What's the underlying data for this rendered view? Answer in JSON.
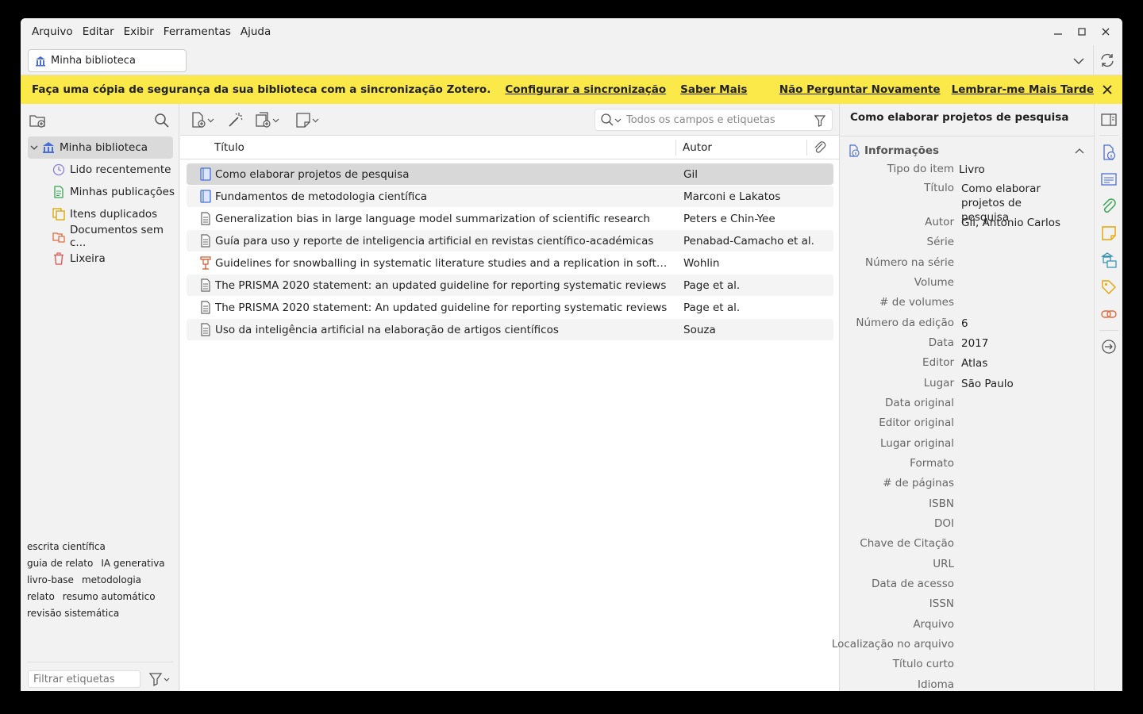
{
  "menu": [
    "Arquivo",
    "Editar",
    "Exibir",
    "Ferramentas",
    "Ajuda"
  ],
  "tab": {
    "label": "Minha biblioteca"
  },
  "banner": {
    "message": "Faça uma cópia de segurança da sua biblioteca com a sincronização Zotero.",
    "configure": "Configurar a sincronização",
    "learn_more": "Saber Mais",
    "dont_ask": "Não Perguntar Novamente",
    "remind_later": "Lembrar-me Mais Tarde",
    "color": "#fbe94a"
  },
  "collections": [
    {
      "label": "Minha biblioteca",
      "icon": "library-icon",
      "selected": true
    },
    {
      "label": "Lido recentemente",
      "icon": "clock-icon"
    },
    {
      "label": "Minhas publicações",
      "icon": "publications-icon"
    },
    {
      "label": "Itens duplicados",
      "icon": "duplicates-icon"
    },
    {
      "label": "Documentos sem c...",
      "icon": "unfiled-icon"
    },
    {
      "label": "Lixeira",
      "icon": "trash-icon"
    }
  ],
  "tags": [
    "escrita científica",
    "guia de relato",
    "IA generativa",
    "livro-base",
    "metodologia",
    "relato",
    "resumo automático",
    "revisão sistemática"
  ],
  "tag_filter_placeholder": "Filtrar etiquetas",
  "search": {
    "placeholder": "Todos os campos e etiquetas"
  },
  "columns": {
    "title": "Título",
    "author": "Autor"
  },
  "items": [
    {
      "title": "Como elaborar projetos de pesquisa",
      "author": "Gil",
      "type": "book"
    },
    {
      "title": "Fundamentos de metodologia científica",
      "author": "Marconi e Lakatos",
      "type": "book"
    },
    {
      "title": "Generalization bias in large language model summarization of scientific research",
      "author": "Peters e Chin-Yee",
      "type": "article"
    },
    {
      "title": "Guía para uso y reporte de inteligencia artificial en revistas científico-académicas",
      "author": "Penabad-Camacho et al.",
      "type": "article"
    },
    {
      "title": "Guidelines for snowballing in systematic literature studies and a replication in software engine...",
      "author": "Wohlin",
      "type": "conference"
    },
    {
      "title": "The PRISMA 2020 statement: an updated guideline for reporting systematic reviews",
      "author": "Page et al.",
      "type": "article"
    },
    {
      "title": "The PRISMA 2020 statement: An updated guideline for reporting systematic reviews",
      "author": "Page et al.",
      "type": "article"
    },
    {
      "title": "Uso da inteligência artificial na elaboração de artigos científicos",
      "author": "Souza",
      "type": "article"
    }
  ],
  "detail": {
    "title": "Como elaborar projetos de pesquisa",
    "section": "Informações",
    "fields": [
      {
        "label": "Tipo do item",
        "value": "Livro"
      },
      {
        "label": "Título",
        "value": "Como elaborar projetos de pesquisa"
      },
      {
        "label": "Autor",
        "value": "Gil, Antonio Carlos"
      },
      {
        "label": "Série",
        "value": ""
      },
      {
        "label": "Número na série",
        "value": ""
      },
      {
        "label": "Volume",
        "value": ""
      },
      {
        "label": "# de volumes",
        "value": ""
      },
      {
        "label": "Número da edição",
        "value": "6"
      },
      {
        "label": "Data",
        "value": "2017"
      },
      {
        "label": "Editor",
        "value": "Atlas"
      },
      {
        "label": "Lugar",
        "value": "São Paulo"
      },
      {
        "label": "Data original",
        "value": ""
      },
      {
        "label": "Editor original",
        "value": ""
      },
      {
        "label": "Lugar original",
        "value": ""
      },
      {
        "label": "Formato",
        "value": ""
      },
      {
        "label": "# de páginas",
        "value": ""
      },
      {
        "label": "ISBN",
        "value": ""
      },
      {
        "label": "DOI",
        "value": ""
      },
      {
        "label": "Chave de Citação",
        "value": ""
      },
      {
        "label": "URL",
        "value": ""
      },
      {
        "label": "Data de acesso",
        "value": ""
      },
      {
        "label": "ISSN",
        "value": ""
      },
      {
        "label": "Arquivo",
        "value": ""
      },
      {
        "label": "Localização no arquivo",
        "value": ""
      },
      {
        "label": "Título curto",
        "value": ""
      },
      {
        "label": "Idioma",
        "value": ""
      }
    ]
  },
  "sidenav": [
    "toggle-pane-icon",
    "info-icon",
    "abstract-icon",
    "attachments-icon",
    "notes-icon",
    "libraries-collections-icon",
    "tags-icon",
    "related-icon",
    "locate-icon"
  ]
}
